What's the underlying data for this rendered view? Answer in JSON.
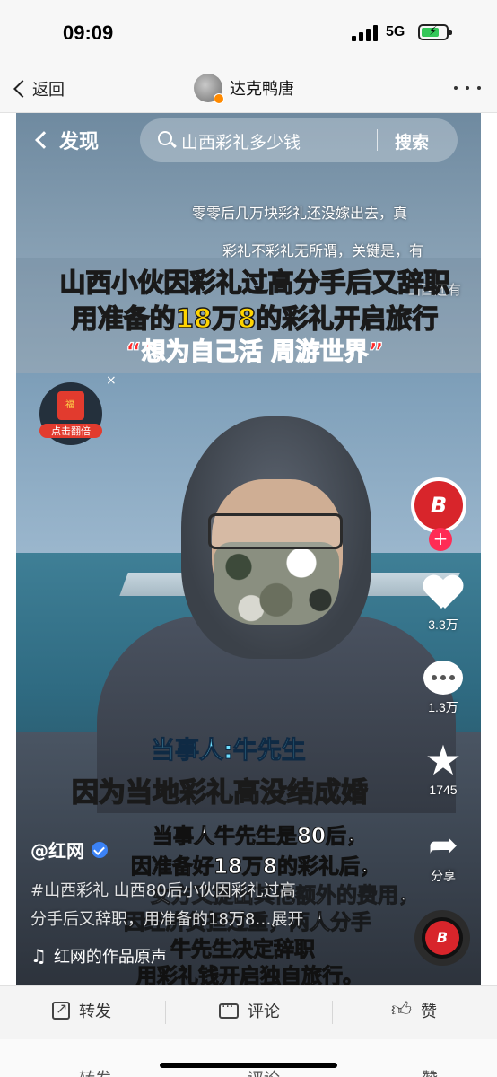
{
  "status_bar": {
    "time": "09:09",
    "network": "5G",
    "battery_icon": "battery-charging-icon",
    "signal_icon": "signal-bars-icon"
  },
  "nav": {
    "back_label": "返回",
    "title": "达克鸭唐",
    "more_icon": "more-dots-icon"
  },
  "video": {
    "back_label": "发现",
    "search": {
      "query": "山西彩礼多少钱",
      "button": "搜索"
    },
    "danmaku": [
      "零零后几万块彩礼还没嫁出去，真",
      "彩礼不彩礼无所谓，关键是，有",
      "山西还有"
    ],
    "headline": {
      "line1": "山西小伙因彩礼过高分手后又辞职",
      "line2": "用准备的18万8的彩礼开启旅行",
      "line3": "“想为自己活 周游世界”"
    },
    "red_packet": {
      "label": "点击翻倍",
      "close": "×"
    },
    "author_logo_text": "B",
    "follow_icon": "+",
    "likes": "3.3万",
    "comments": "1.3万",
    "favorites": "1745",
    "share_label": "分享",
    "captions": {
      "who": "当事人:牛先生",
      "reason": "因为当地彩礼高没结成婚",
      "sub1": "当事人牛先生是80后，",
      "sub2": "因准备好18万8的彩礼后，",
      "sub3": "女方又提出其他额外的费用，",
      "sub4": "因经济负担过重，两人分手",
      "sub5": "牛先生决定辞职",
      "sub6": "用彩礼钱开启独自旅行。"
    },
    "user_handle": "@红网",
    "desc_line1": "#山西彩礼 山西80后小伙因彩礼过高",
    "desc_line2": "分手后又辞职，用准备的18万8…展开",
    "music": "红网的作品原声"
  },
  "actions": {
    "forward": "转发",
    "comment": "评论",
    "like": "赞"
  },
  "ghost": {
    "forward": "转发",
    "comment": "评论",
    "like": "赞"
  }
}
